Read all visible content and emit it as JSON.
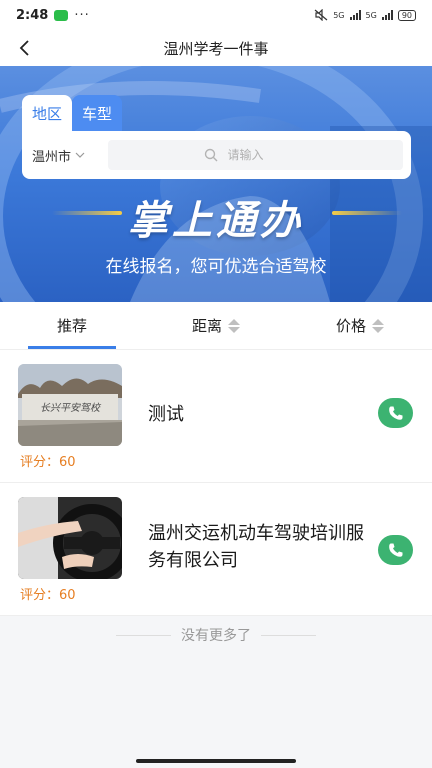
{
  "status_bar": {
    "time": "2:48",
    "dots": "···",
    "network_1": "5G",
    "network_2": "5G",
    "battery": "90"
  },
  "nav": {
    "title": "温州学考一件事"
  },
  "banner": {
    "tabs": [
      {
        "label": "地区",
        "active": true
      },
      {
        "label": "车型",
        "active": false
      }
    ],
    "city": "温州市",
    "search_placeholder": "请输入",
    "slogan": "掌上通办",
    "subtitle": "在线报名，您可优选合适驾校"
  },
  "sort_bar": {
    "items": [
      {
        "label": "推荐",
        "active": true,
        "sortable": false
      },
      {
        "label": "距离",
        "active": false,
        "sortable": true
      },
      {
        "label": "价格",
        "active": false,
        "sortable": true
      }
    ]
  },
  "schools": [
    {
      "name": "测试",
      "score_label": "评分：60",
      "thumb_text": "长兴平安驾校"
    },
    {
      "name": "温州交运机动车驾驶培训服务有限公司",
      "score_label": "评分：60"
    }
  ],
  "footer": {
    "no_more": "没有更多了"
  },
  "colors": {
    "accent": "#3a7ee8",
    "phone": "#3cb371",
    "score": "#e67e22"
  }
}
